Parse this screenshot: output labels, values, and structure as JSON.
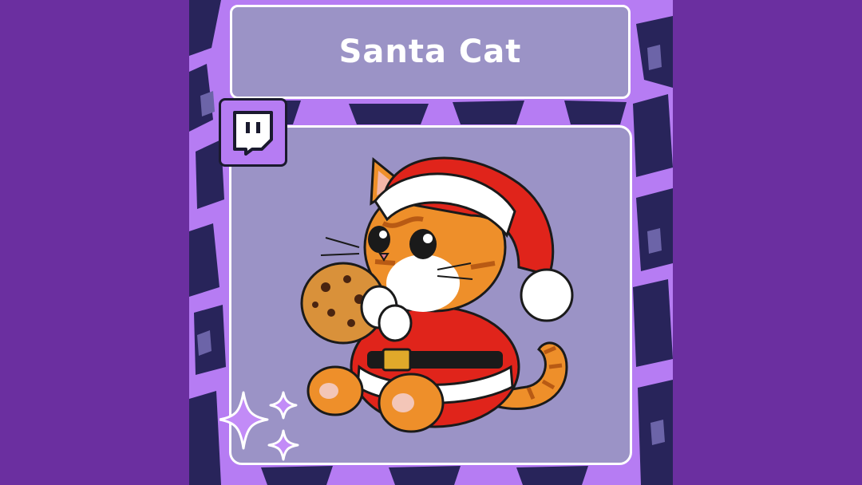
{
  "title": "Santa Cat",
  "icons": {
    "badge": "twitch-logo-icon",
    "sparkles": "sparkle-icon"
  },
  "colors": {
    "background": "#6b2fa0",
    "poster_purple": "#b67cf3",
    "panel": "#9b93c6",
    "pattern_dark": "#28245a",
    "santa_red": "#e0241b",
    "fur_orange": "#ee8f2a"
  }
}
